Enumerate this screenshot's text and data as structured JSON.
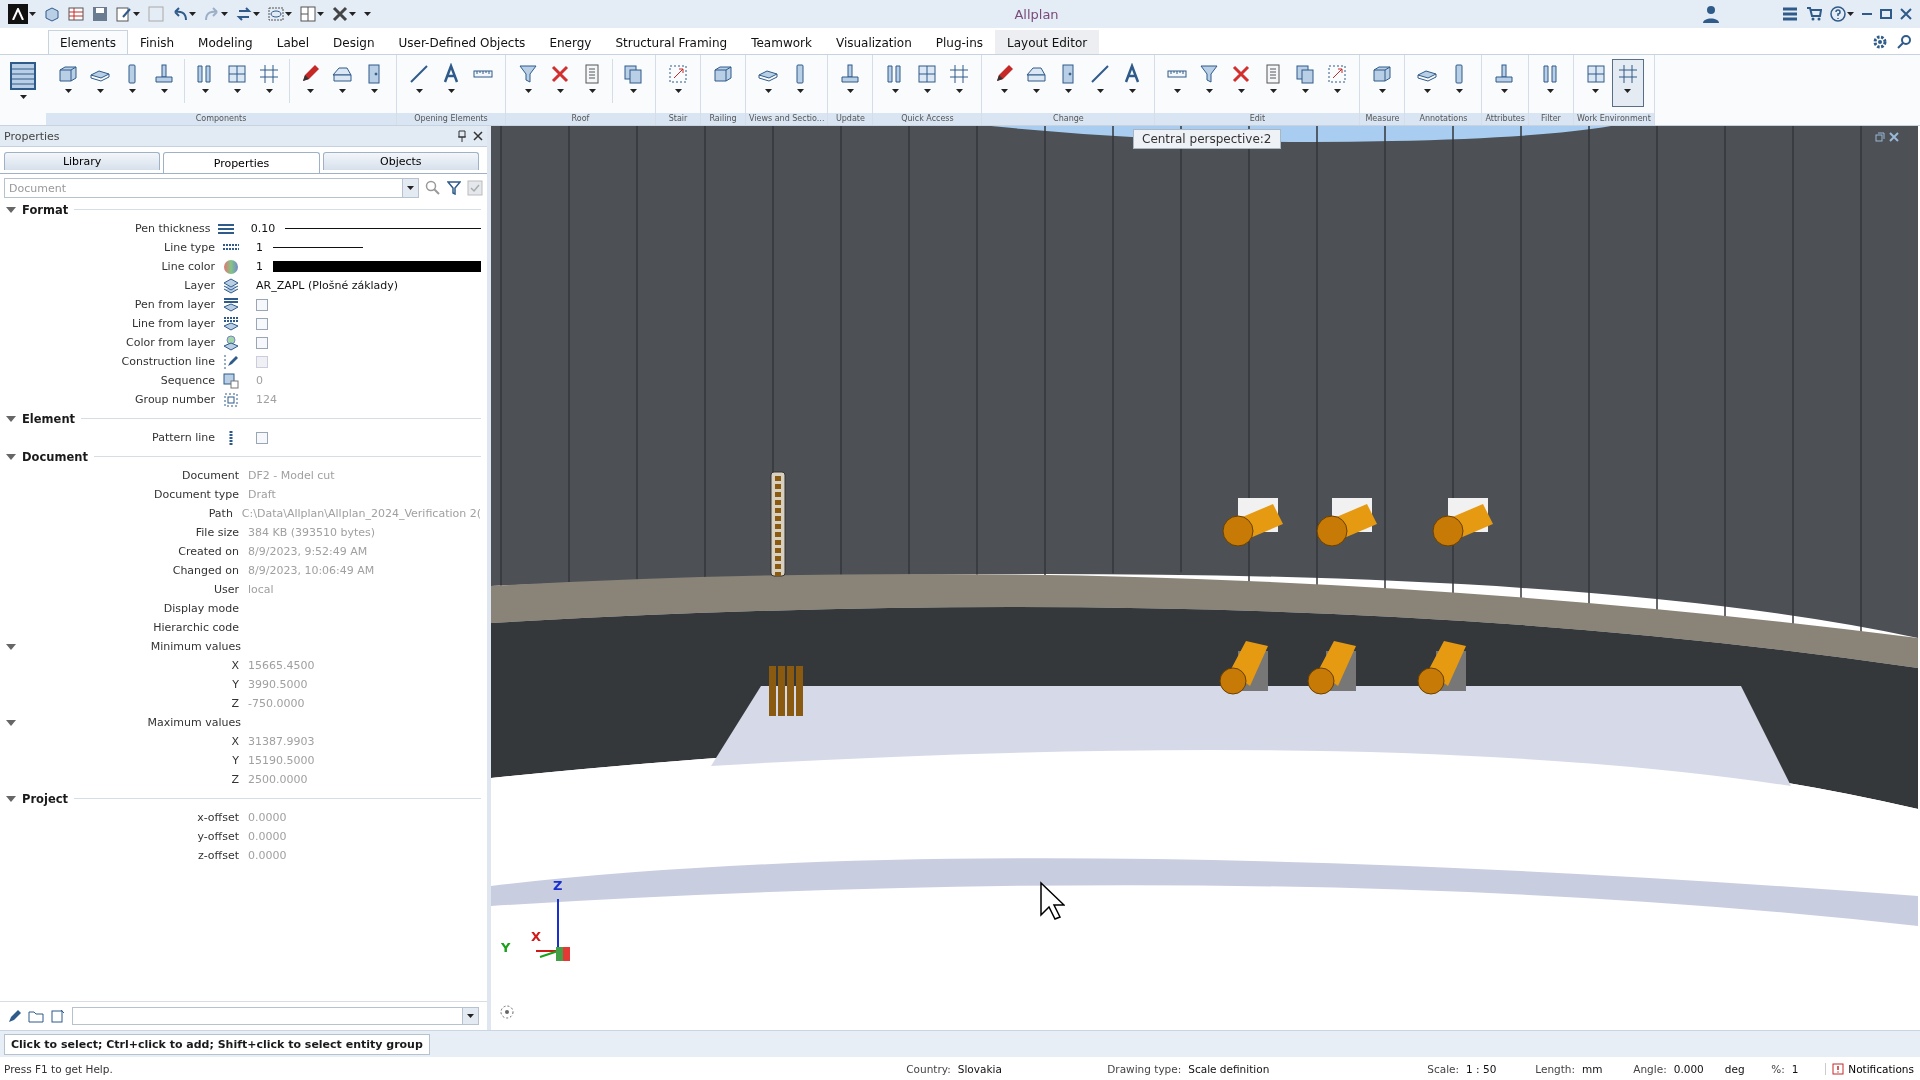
{
  "title_bar": {
    "title": "Allplan"
  },
  "menu_tabs": [
    {
      "label": "Elements",
      "selected": true,
      "contextual": false
    },
    {
      "label": "Finish",
      "selected": false,
      "contextual": false
    },
    {
      "label": "Modeling",
      "selected": false,
      "contextual": false
    },
    {
      "label": "Label",
      "selected": false,
      "contextual": false
    },
    {
      "label": "Design",
      "selected": false,
      "contextual": false
    },
    {
      "label": "User-Defined Objects",
      "selected": false,
      "contextual": false
    },
    {
      "label": "Energy",
      "selected": false,
      "contextual": false
    },
    {
      "label": "Structural Framing",
      "selected": false,
      "contextual": false
    },
    {
      "label": "Teamwork",
      "selected": false,
      "contextual": false
    },
    {
      "label": "Visualization",
      "selected": false,
      "contextual": false
    },
    {
      "label": "Plug-ins",
      "selected": false,
      "contextual": false
    },
    {
      "label": "Layout Editor",
      "selected": false,
      "contextual": true
    }
  ],
  "ribbon_groups": [
    {
      "label": "Components",
      "tools": [
        {
          "kind": "tool",
          "dropdown": true,
          "pressed": false
        },
        {
          "kind": "tool",
          "dropdown": true,
          "pressed": false
        },
        {
          "kind": "tool",
          "dropdown": true,
          "pressed": false
        },
        {
          "kind": "tool",
          "dropdown": true,
          "pressed": false
        },
        {
          "kind": "separator"
        },
        {
          "kind": "tool",
          "dropdown": true,
          "pressed": false
        },
        {
          "kind": "tool",
          "dropdown": true,
          "pressed": false
        },
        {
          "kind": "tool",
          "dropdown": true,
          "pressed": false
        },
        {
          "kind": "separator"
        },
        {
          "kind": "tool",
          "dropdown": true,
          "pressed": false
        },
        {
          "kind": "tool",
          "dropdown": true,
          "pressed": false
        },
        {
          "kind": "tool",
          "dropdown": true,
          "pressed": false
        }
      ]
    },
    {
      "label": "Opening Elements",
      "tools": [
        {
          "kind": "tool",
          "dropdown": true,
          "pressed": false
        },
        {
          "kind": "tool",
          "dropdown": true,
          "pressed": false
        },
        {
          "kind": "tool",
          "dropdown": false,
          "pressed": false
        }
      ]
    },
    {
      "label": "Roof",
      "tools": [
        {
          "kind": "tool",
          "dropdown": true,
          "pressed": false
        },
        {
          "kind": "tool",
          "dropdown": true,
          "pressed": false
        },
        {
          "kind": "tool",
          "dropdown": true,
          "pressed": false
        },
        {
          "kind": "separator"
        },
        {
          "kind": "tool",
          "dropdown": true,
          "pressed": false
        }
      ]
    },
    {
      "label": "Stair",
      "tools": [
        {
          "kind": "tool",
          "dropdown": true,
          "pressed": false
        }
      ]
    },
    {
      "label": "Railing",
      "tools": [
        {
          "kind": "tool",
          "dropdown": false,
          "pressed": false
        }
      ]
    },
    {
      "label": "Views and Sectio...",
      "tools": [
        {
          "kind": "tool",
          "dropdown": true,
          "pressed": false
        },
        {
          "kind": "tool",
          "dropdown": true,
          "pressed": false
        }
      ]
    },
    {
      "label": "Update",
      "tools": [
        {
          "kind": "tool",
          "dropdown": true,
          "pressed": false
        }
      ]
    },
    {
      "label": "Quick Access",
      "tools": [
        {
          "kind": "tool",
          "dropdown": true,
          "pressed": false
        },
        {
          "kind": "tool",
          "dropdown": true,
          "pressed": false
        },
        {
          "kind": "tool",
          "dropdown": true,
          "pressed": false
        }
      ]
    },
    {
      "label": "Change",
      "tools": [
        {
          "kind": "tool",
          "dropdown": true,
          "pressed": false
        },
        {
          "kind": "tool",
          "dropdown": true,
          "pressed": false
        },
        {
          "kind": "tool",
          "dropdown": true,
          "pressed": false
        },
        {
          "kind": "tool",
          "dropdown": true,
          "pressed": false
        },
        {
          "kind": "tool",
          "dropdown": true,
          "pressed": false
        }
      ]
    },
    {
      "label": "Edit",
      "tools": [
        {
          "kind": "tool",
          "dropdown": true,
          "pressed": false
        },
        {
          "kind": "tool",
          "dropdown": true,
          "pressed": false
        },
        {
          "kind": "tool",
          "dropdown": true,
          "pressed": false
        },
        {
          "kind": "tool",
          "dropdown": true,
          "pressed": false
        },
        {
          "kind": "tool",
          "dropdown": true,
          "pressed": false
        },
        {
          "kind": "tool",
          "dropdown": true,
          "pressed": false
        }
      ]
    },
    {
      "label": "Measure",
      "tools": [
        {
          "kind": "tool",
          "dropdown": true,
          "pressed": false
        }
      ]
    },
    {
      "label": "Annotations",
      "tools": [
        {
          "kind": "tool",
          "dropdown": true,
          "pressed": false
        },
        {
          "kind": "tool",
          "dropdown": true,
          "pressed": false
        }
      ]
    },
    {
      "label": "Attributes",
      "tools": [
        {
          "kind": "tool",
          "dropdown": true,
          "pressed": false
        }
      ]
    },
    {
      "label": "Filter",
      "tools": [
        {
          "kind": "tool",
          "dropdown": true,
          "pressed": false
        }
      ]
    },
    {
      "label": "Work Environment",
      "tools": [
        {
          "kind": "tool",
          "dropdown": true,
          "pressed": false
        },
        {
          "kind": "tool",
          "dropdown": true,
          "pressed": true
        }
      ]
    }
  ],
  "panel": {
    "title": "Properties",
    "tabs": [
      {
        "label": "Library",
        "selected": false
      },
      {
        "label": "Properties",
        "selected": true
      },
      {
        "label": "Objects",
        "selected": false
      }
    ],
    "filter": {
      "placeholder": "Document"
    },
    "sections": [
      {
        "title": "Format",
        "expanded": true,
        "rows": [
          {
            "label": "Pen thickness",
            "kind": "pen",
            "value": "0.10",
            "disabled": false
          },
          {
            "label": "Line type",
            "kind": "line",
            "value": "1",
            "disabled": false
          },
          {
            "label": "Line color",
            "kind": "color",
            "value": "1",
            "color": "#000000",
            "disabled": false
          },
          {
            "label": "Layer",
            "kind": "text",
            "value": "AR_ZAPL (Plošné základy)",
            "disabled": false
          },
          {
            "label": "Pen from layer",
            "kind": "checkbox",
            "checked": false,
            "disabled": false
          },
          {
            "label": "Line from layer",
            "kind": "checkbox",
            "checked": false,
            "disabled": false
          },
          {
            "label": "Color from layer",
            "kind": "checkbox",
            "checked": false,
            "disabled": false
          },
          {
            "label": "Construction line",
            "kind": "checkbox",
            "checked": false,
            "disabled": true
          },
          {
            "label": "Sequence",
            "kind": "text",
            "value": "0",
            "disabled": true
          },
          {
            "label": "Group number",
            "kind": "text",
            "value": "124",
            "disabled": true
          }
        ]
      },
      {
        "title": "Element",
        "expanded": true,
        "rows": [
          {
            "label": "Pattern line",
            "kind": "checkbox",
            "checked": false,
            "disabled": false
          }
        ]
      },
      {
        "title": "Document",
        "expanded": true,
        "rows": [
          {
            "label": "Document",
            "kind": "text",
            "value": "DF2 - Model cut",
            "disabled": true
          },
          {
            "label": "Document type",
            "kind": "text",
            "value": "Draft",
            "disabled": true
          },
          {
            "label": "Path",
            "kind": "text",
            "value": "C:\\Data\\Allplan\\Allplan_2024_Verification 2(",
            "disabled": true
          },
          {
            "label": "File size",
            "kind": "text",
            "value": "384 KB (393510 bytes)",
            "disabled": true
          },
          {
            "label": "Created on",
            "kind": "text",
            "value": "8/9/2023, 9:52:49 AM",
            "disabled": true
          },
          {
            "label": "Changed on",
            "kind": "text",
            "value": "8/9/2023, 10:06:49 AM",
            "disabled": true
          },
          {
            "label": "User",
            "kind": "text",
            "value": "local",
            "disabled": true
          },
          {
            "label": "Display mode",
            "kind": "label"
          },
          {
            "label": "Hierarchic code",
            "kind": "label"
          },
          {
            "label": "Minimum values",
            "kind": "group",
            "expanded": true,
            "children": [
              {
                "label": "X",
                "kind": "text",
                "value": "15665.4500",
                "disabled": true
              },
              {
                "label": "Y",
                "kind": "text",
                "value": "3990.5000",
                "disabled": true
              },
              {
                "label": "Z",
                "kind": "text",
                "value": "-750.0000",
                "disabled": true
              }
            ]
          },
          {
            "label": "Maximum values",
            "kind": "group",
            "expanded": true,
            "children": [
              {
                "label": "X",
                "kind": "text",
                "value": "31387.9903",
                "disabled": true
              },
              {
                "label": "Y",
                "kind": "text",
                "value": "15190.5000",
                "disabled": true
              },
              {
                "label": "Z",
                "kind": "text",
                "value": "2500.0000",
                "disabled": true
              }
            ]
          }
        ]
      },
      {
        "title": "Project",
        "expanded": true,
        "rows": [
          {
            "label": "x-offset",
            "kind": "text",
            "value": "0.0000",
            "disabled": true
          },
          {
            "label": "y-offset",
            "kind": "text",
            "value": "0.0000",
            "disabled": true
          },
          {
            "label": "z-offset",
            "kind": "text",
            "value": "0.0000",
            "disabled": true
          }
        ]
      }
    ]
  },
  "viewport": {
    "view_label": "Central perspective:2",
    "axes": {
      "z": "Z",
      "x": "X",
      "y": "Y"
    }
  },
  "prompt": "Click to select; Ctrl+click to add; Shift+click to select entity group",
  "status_bar": {
    "help": "Press F1 to get Help.",
    "items": [
      {
        "label": "Country:",
        "value": "Slovakia"
      },
      {
        "label": "Drawing type:",
        "value": "Scale definition"
      },
      {
        "label": "Scale:",
        "value": "1 : 50"
      },
      {
        "label": "Length:",
        "value": "mm"
      },
      {
        "label": "Angle:",
        "value": "0.000",
        "unit": "deg"
      },
      {
        "label": "%:",
        "value": "1"
      }
    ],
    "notifications": "Notifications"
  }
}
